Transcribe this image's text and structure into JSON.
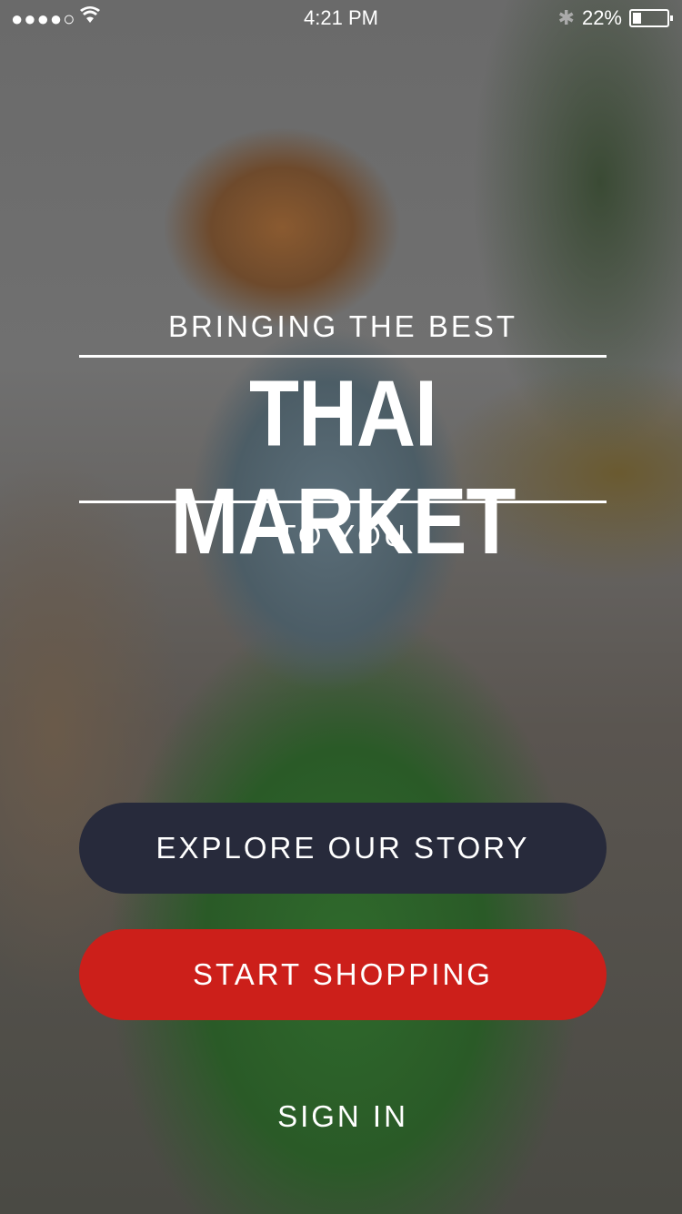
{
  "status": {
    "carrier": "●●●●○",
    "wifi": "wifi-icon",
    "time": "4:21 PM",
    "bluetooth": "✱",
    "battery": "22%"
  },
  "hero": {
    "line1": "BRINGING THE BEST",
    "title": "THAI MARKET",
    "line2": "TO YOU"
  },
  "buttons": {
    "explore": "EXPLORE OUR STORY",
    "shop": "START SHOPPING",
    "signin": "SIGN IN"
  },
  "colors": {
    "explore": "#272a3b",
    "shop": "#cc1f1a"
  }
}
